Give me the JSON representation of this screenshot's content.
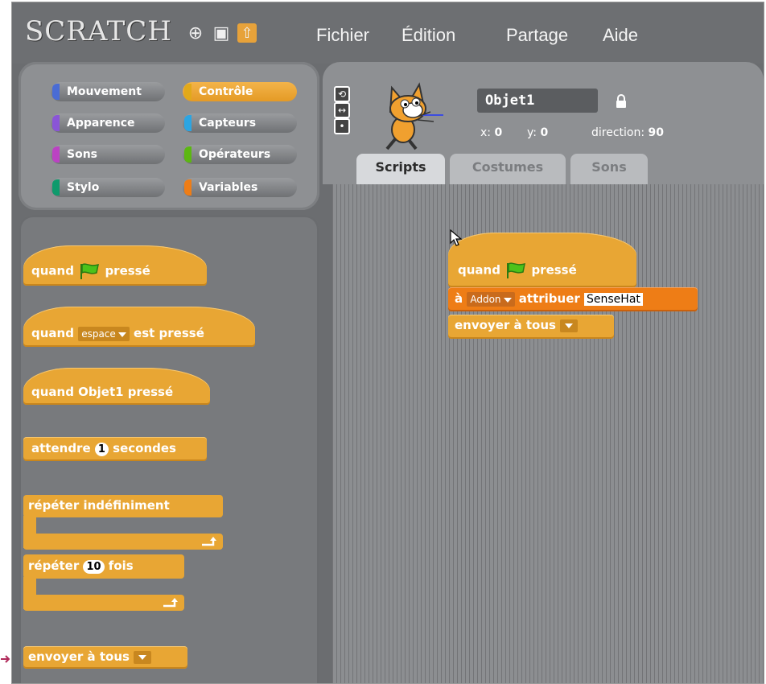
{
  "app": {
    "logo": "SCRATCH"
  },
  "toolbar": {
    "globe_icon": "⊕",
    "save_icon": "▣",
    "share_icon": "⇧"
  },
  "menu": {
    "file": "Fichier",
    "edit": "Édition",
    "share": "Partage",
    "help": "Aide"
  },
  "categories": [
    {
      "label": "Mouvement",
      "color": "#4a6cd4"
    },
    {
      "label": "Contrôle",
      "color": "#e1a91a"
    },
    {
      "label": "Apparence",
      "color": "#8a55d7"
    },
    {
      "label": "Capteurs",
      "color": "#2ca5e2"
    },
    {
      "label": "Sons",
      "color": "#bb42c3"
    },
    {
      "label": "Opérateurs",
      "color": "#5cb712"
    },
    {
      "label": "Stylo",
      "color": "#0e9a6c"
    },
    {
      "label": "Variables",
      "color": "#ee7d16"
    }
  ],
  "palette": {
    "when_flag_pre": "quand",
    "when_flag_post": "pressé",
    "when_key_pre": "quand",
    "when_key_value": "espace",
    "when_key_post": "est pressé",
    "when_sprite": "quand Objet1 pressé",
    "wait_pre": "attendre",
    "wait_value": "1",
    "wait_post": "secondes",
    "forever": "répéter indéfiniment",
    "repeat_pre": "répéter",
    "repeat_value": "10",
    "repeat_post": "fois",
    "broadcast": "envoyer à tous"
  },
  "sprite": {
    "name": "Objet1",
    "x_label": "x:",
    "x_value": "0",
    "y_label": "y:",
    "y_value": "0",
    "direction_label": "direction:",
    "direction_value": "90"
  },
  "tabs": [
    "Scripts",
    "Costumes",
    "Sons"
  ],
  "script": {
    "hat_pre": "quand",
    "hat_post": "pressé",
    "set_pre": "à",
    "set_dropdown": "Addon",
    "set_mid": "attribuer",
    "set_value": "SenseHat",
    "broadcast": "envoyer à tous"
  },
  "colors": {
    "control": "#e8a634",
    "variables": "#ee7d16",
    "background": "#6d6f72"
  }
}
